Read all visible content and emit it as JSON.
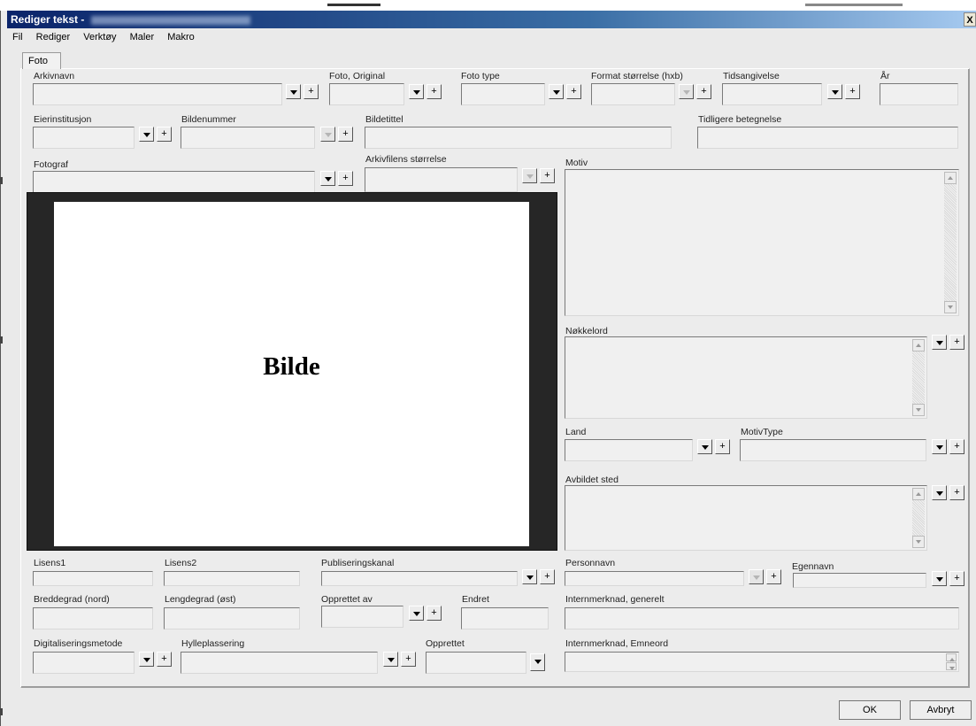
{
  "window": {
    "title": "Rediger tekst - ",
    "close_label": "X"
  },
  "menu": [
    "Fil",
    "Rediger",
    "Verktøy",
    "Maler",
    "Makro"
  ],
  "tab": "Foto",
  "labels": {
    "arkivnavn": "Arkivnavn",
    "foto_original": "Foto, Original",
    "foto_type": "Foto type",
    "format": "Format størrelse (hxb)",
    "tidsangivelse": "Tidsangivelse",
    "ar": "År",
    "eierinstitusjon": "Eierinstitusjon",
    "bildenummer": "Bildenummer",
    "bildetittel": "Bildetittel",
    "tidligere": "Tidligere betegnelse",
    "fotograf": "Fotograf",
    "arkivfil": "Arkivfilens størrelse",
    "motiv": "Motiv",
    "nokkelord": "Nøkkelord",
    "land": "Land",
    "motivtype": "MotivType",
    "avbildet": "Avbildet sted",
    "lisens1": "Lisens1",
    "lisens2": "Lisens2",
    "publisering": "Publiseringskanal",
    "personnavn": "Personnavn",
    "egennavn": "Egennavn",
    "breddegrad": "Breddegrad (nord)",
    "lengdegrad": "Lengdegrad (øst)",
    "opprettet_av": "Opprettet av",
    "endret": "Endret",
    "intern_generelt": "Internmerknad, generelt",
    "digitalisering": "Digitaliseringsmetode",
    "hylle": "Hylleplassering",
    "opprettet": "Opprettet",
    "intern_emneord": "Internmerknad, Emneord"
  },
  "image_label": "Bilde",
  "buttons": {
    "ok": "OK",
    "cancel": "Avbryt",
    "add": "+"
  }
}
